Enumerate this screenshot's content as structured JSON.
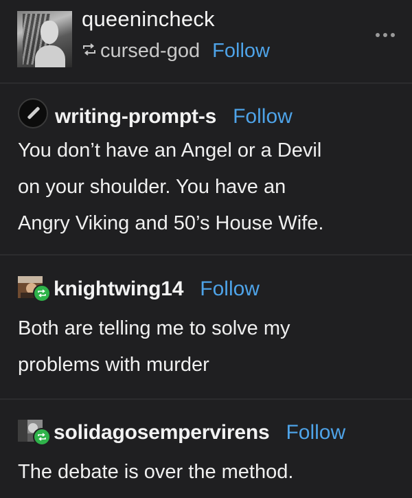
{
  "header": {
    "username": "queenincheck",
    "reblogged_from": "cursed-god",
    "follow_label": "Follow"
  },
  "posts": [
    {
      "author": "writing-prompt-s",
      "follow_label": "Follow",
      "lines": [
        "You don’t have an Angel or a Devil",
        "on your shoulder. You have an",
        "Angry Viking and 50’s House Wife."
      ]
    },
    {
      "author": "knightwing14",
      "follow_label": "Follow",
      "lines": [
        "Both are telling me to solve my",
        "problems with murder"
      ]
    },
    {
      "author": "solidagosempervirens",
      "follow_label": "Follow",
      "lines": [
        "The debate is over the method."
      ]
    }
  ],
  "colors": {
    "background": "#1f1f21",
    "follow": "#4ea3e8",
    "text": "#f0f0f0",
    "reblog_badge": "#2fb34a"
  },
  "icons": {
    "more": "more-horizontal-icon",
    "reblog": "reblog-icon"
  }
}
